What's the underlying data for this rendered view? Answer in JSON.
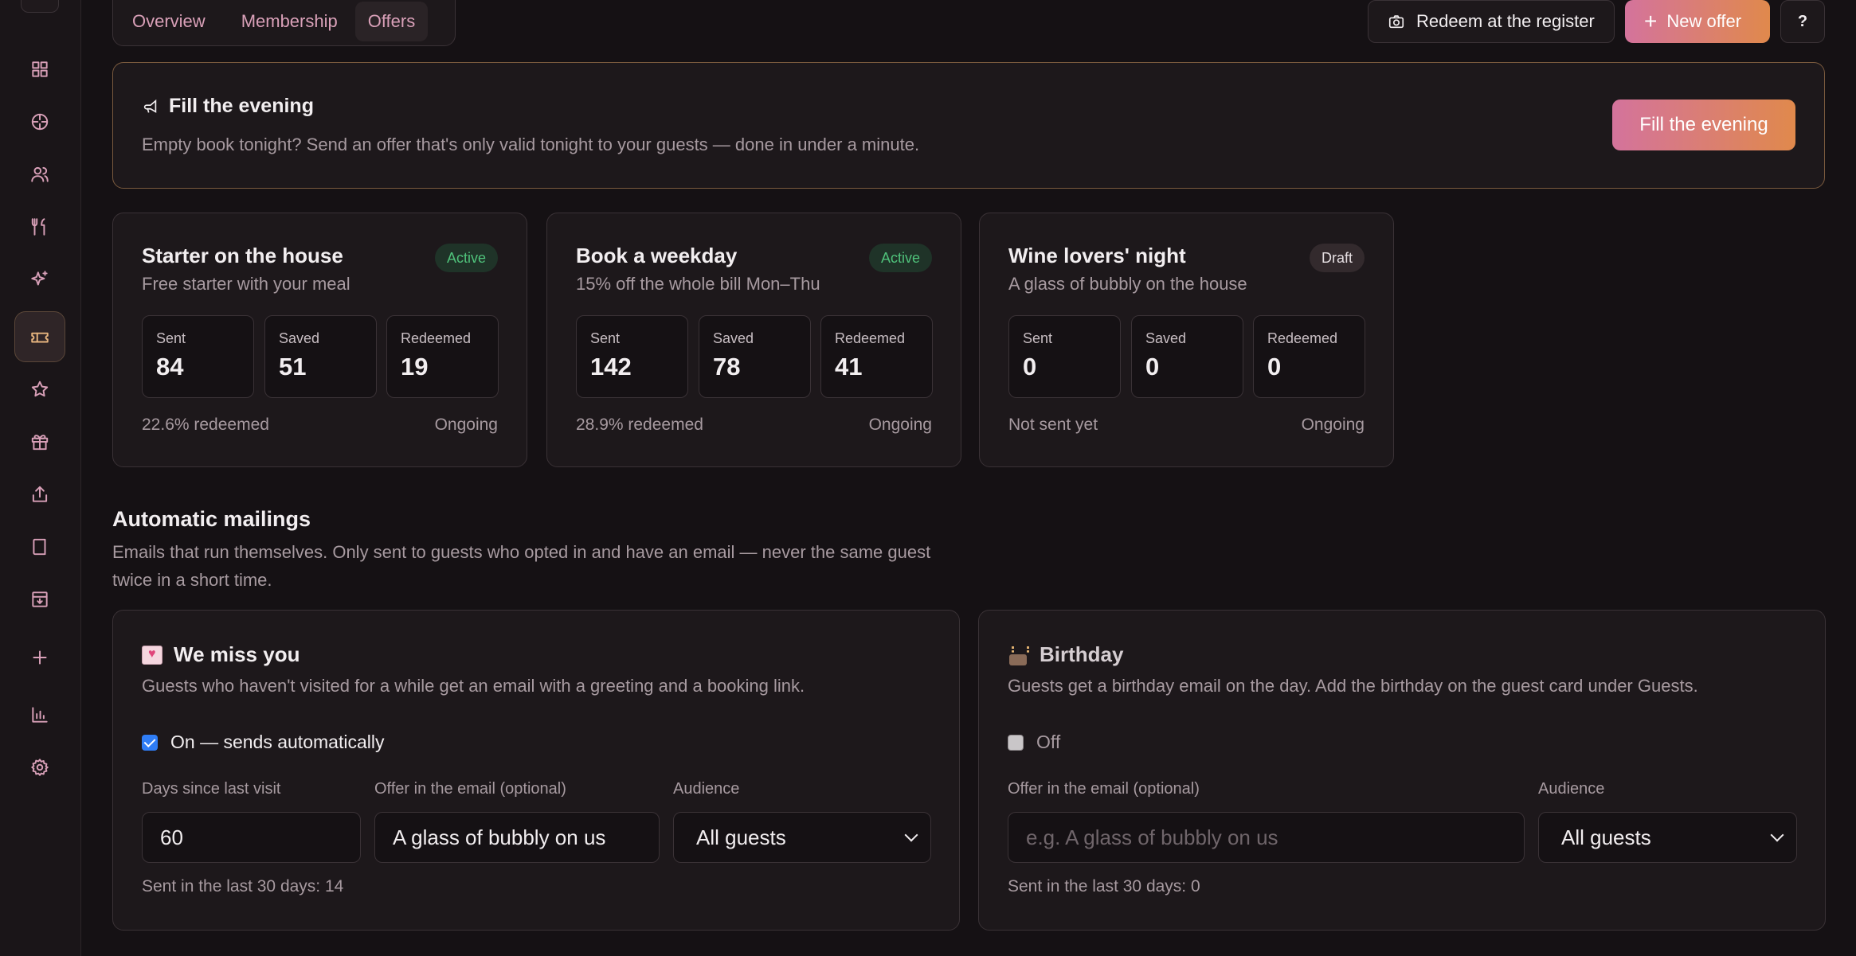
{
  "tabs": [
    "Overview",
    "Membership",
    "Offers"
  ],
  "header": {
    "register_label": "Redeem at the register",
    "new_offer_label": "New offer",
    "help_label": "?"
  },
  "banner": {
    "title": "Fill the evening",
    "description": "Empty book tonight? Send an offer that's only valid tonight to your guests — done in under a minute.",
    "button_label": "Fill the evening"
  },
  "sidebar": {
    "icons": [
      "dashboard-icon",
      "reservations-icon",
      "guests-icon",
      "menu-icon",
      "sparkle-icon",
      "offers-icon",
      "star-icon",
      "gift-icon",
      "share-icon",
      "book-icon",
      "archive-icon",
      "add-icon",
      "chart-icon",
      "settings-icon"
    ],
    "active": "offers-icon"
  },
  "offers": [
    {
      "name": "Starter on the house",
      "subtitle": "Free starter with your meal",
      "status": "Active",
      "stats": [
        {
          "label": "Sent",
          "value": "84"
        },
        {
          "label": "Saved",
          "value": "51"
        },
        {
          "label": "Redeemed",
          "value": "19"
        }
      ],
      "footer_left": "22.6% redeemed",
      "footer_right": "Ongoing"
    },
    {
      "name": "Book a weekday",
      "subtitle": "15% off the whole bill Mon–Thu",
      "status": "Active",
      "stats": [
        {
          "label": "Sent",
          "value": "142"
        },
        {
          "label": "Saved",
          "value": "78"
        },
        {
          "label": "Redeemed",
          "value": "41"
        }
      ],
      "footer_left": "28.9% redeemed",
      "footer_right": "Ongoing"
    },
    {
      "name": "Wine lovers' night",
      "subtitle": "A glass of bubbly on the house",
      "status": "Draft",
      "stats": [
        {
          "label": "Sent",
          "value": "0"
        },
        {
          "label": "Saved",
          "value": "0"
        },
        {
          "label": "Redeemed",
          "value": "0"
        }
      ],
      "footer_left": "Not sent yet",
      "footer_right": "Ongoing"
    }
  ],
  "mailings": {
    "title": "Automatic mailings",
    "description": "Emails that run themselves. Only sent to guests who opted in and have an email — never the same guest twice in a short time.",
    "we_miss_you": {
      "title": "We miss you",
      "description": "Guests who haven't visited for a while get an email with a greeting and a booking link.",
      "toggle_label": "On — sends automatically",
      "enabled": true,
      "days_label": "Days since last visit",
      "days_value": "60",
      "offer_label": "Offer in the email (optional)",
      "offer_value": "A glass of bubbly on us",
      "audience_label": "Audience",
      "audience_value": "All guests",
      "footer": "Sent in the last 30 days: 14"
    },
    "birthday": {
      "title": "Birthday",
      "description": "Guests get a birthday email on the day. Add the birthday on the guest card under Guests.",
      "toggle_label": "Off",
      "enabled": false,
      "offer_label": "Offer in the email (optional)",
      "offer_placeholder": "e.g. A glass of bubbly on us",
      "audience_label": "Audience",
      "audience_value": "All guests",
      "footer": "Sent in the last 30 days: 0"
    }
  },
  "colors": {
    "background": "#151114",
    "card": "#1d181b",
    "accent_pink": "#d4739c",
    "accent_orange": "#e0894c",
    "active_green": "#4fc17a",
    "checkbox_blue": "#2f7df6"
  }
}
